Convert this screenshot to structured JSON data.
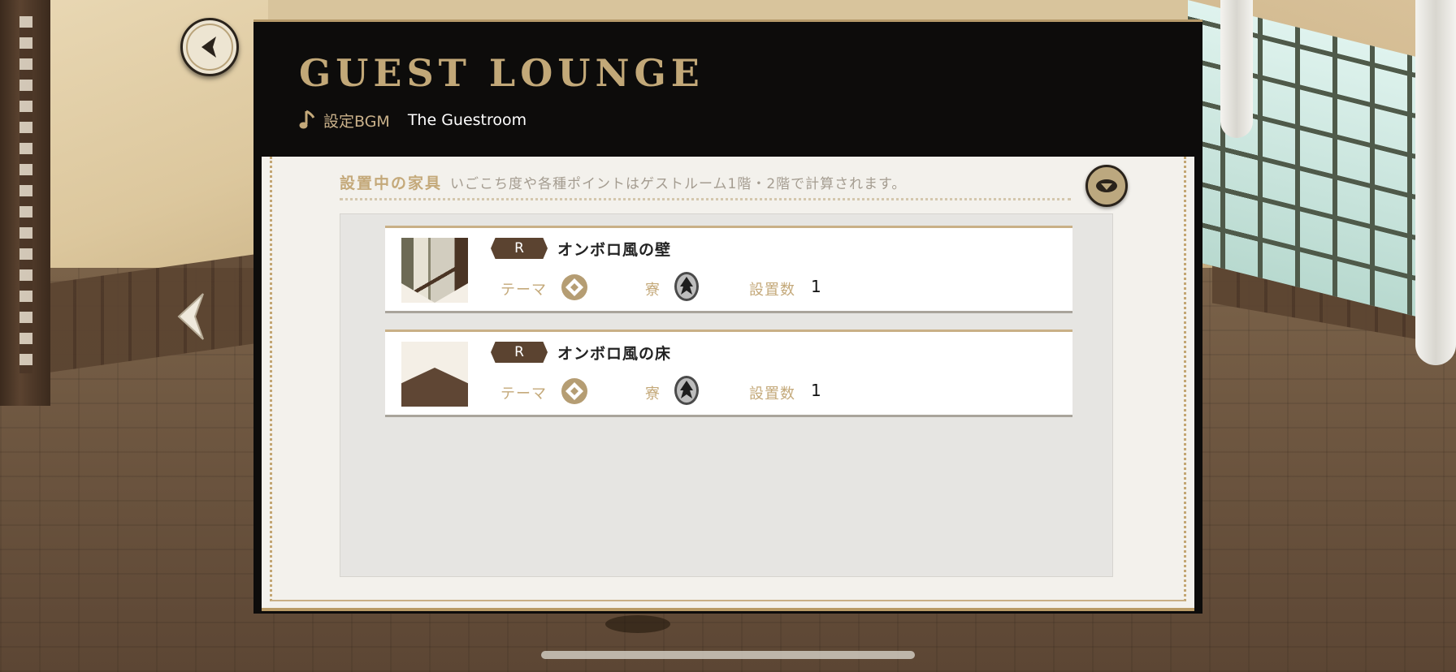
{
  "header": {
    "title": "GUEST LOUNGE",
    "bgm_label": "設定BGM",
    "bgm_value": "The Guestroom"
  },
  "section": {
    "title": "設置中の家具",
    "note": "いごこち度や各種ポイントはゲストルーム1階・2階で計算されます。"
  },
  "attribute_labels": {
    "theme": "テーマ",
    "dorm": "寮",
    "count": "設置数"
  },
  "items": [
    {
      "rarity": "R",
      "name": "オンボロ風の壁",
      "count": "1",
      "thumbnail": "wall-thumbnail",
      "theme_icon": "diamond-icon",
      "dorm_icon": "dorm-crest-icon"
    },
    {
      "rarity": "R",
      "name": "オンボロ風の床",
      "count": "1",
      "thumbnail": "floor-thumbnail",
      "theme_icon": "diamond-icon",
      "dorm_icon": "dorm-crest-icon"
    }
  ],
  "icons": {
    "back": "back-arrow-icon",
    "collapse": "chevron-down-icon",
    "previous": "left-arrow-icon",
    "music": "music-note-icon"
  },
  "colors": {
    "accent_gold": "#c4a97a",
    "panel_black": "#0d0c0b",
    "badge_brown": "#5b4330"
  }
}
